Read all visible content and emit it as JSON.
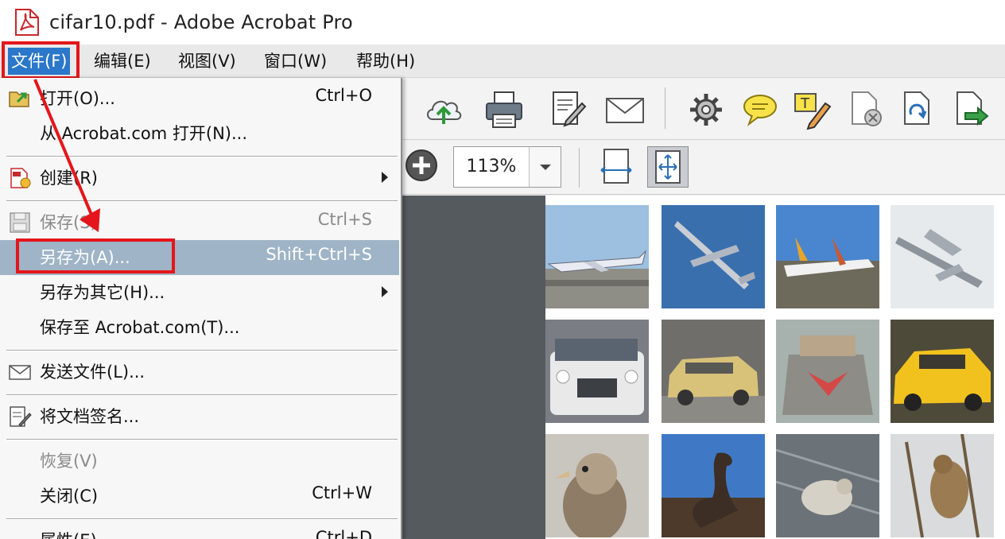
{
  "window": {
    "title": "cifar10.pdf - Adobe Acrobat Pro"
  },
  "menubar": {
    "items": [
      {
        "label": "文件(F)",
        "active": true
      },
      {
        "label": "编辑(E)"
      },
      {
        "label": "视图(V)"
      },
      {
        "label": "窗口(W)"
      },
      {
        "label": "帮助(H)"
      }
    ]
  },
  "file_menu": {
    "items": [
      {
        "label": "打开(O)...",
        "shortcut": "Ctrl+O",
        "icon": "folder-open-icon"
      },
      {
        "label": "从 Acrobat.com 打开(N)...",
        "shortcut": ""
      },
      {
        "label": "创建(R)",
        "shortcut": "",
        "submenu": true,
        "icon": "create-pdf-icon"
      },
      {
        "label": "保存(S)",
        "shortcut": "Ctrl+S",
        "disabled": true,
        "icon": "save-icon"
      },
      {
        "label": "另存为(A)...",
        "shortcut": "Shift+Ctrl+S",
        "highlighted": true
      },
      {
        "label": "另存为其它(H)...",
        "shortcut": "",
        "submenu": true
      },
      {
        "label": "保存至 Acrobat.com(T)...",
        "shortcut": ""
      },
      {
        "label": "发送文件(L)...",
        "shortcut": "",
        "icon": "envelope-icon"
      },
      {
        "label": "将文档签名...",
        "shortcut": "",
        "icon": "sign-icon"
      },
      {
        "label": "恢复(V)",
        "shortcut": "",
        "disabled": true
      },
      {
        "label": "关闭(C)",
        "shortcut": "Ctrl+W"
      },
      {
        "label": "属性(E)...",
        "shortcut": "Ctrl+D"
      }
    ]
  },
  "toolbar": {
    "icons": [
      "cloud-upload-icon",
      "printer-icon",
      "edit-document-icon",
      "envelope-icon",
      "gear-icon",
      "comment-icon",
      "text-markup-icon",
      "delete-file-icon",
      "rotate-page-icon",
      "export-icon"
    ]
  },
  "zoom": {
    "value": "113%"
  },
  "colors": {
    "accent": "#2b77c9",
    "highlight_border": "#e4161b",
    "menu_hover": "#9fb4c6"
  }
}
